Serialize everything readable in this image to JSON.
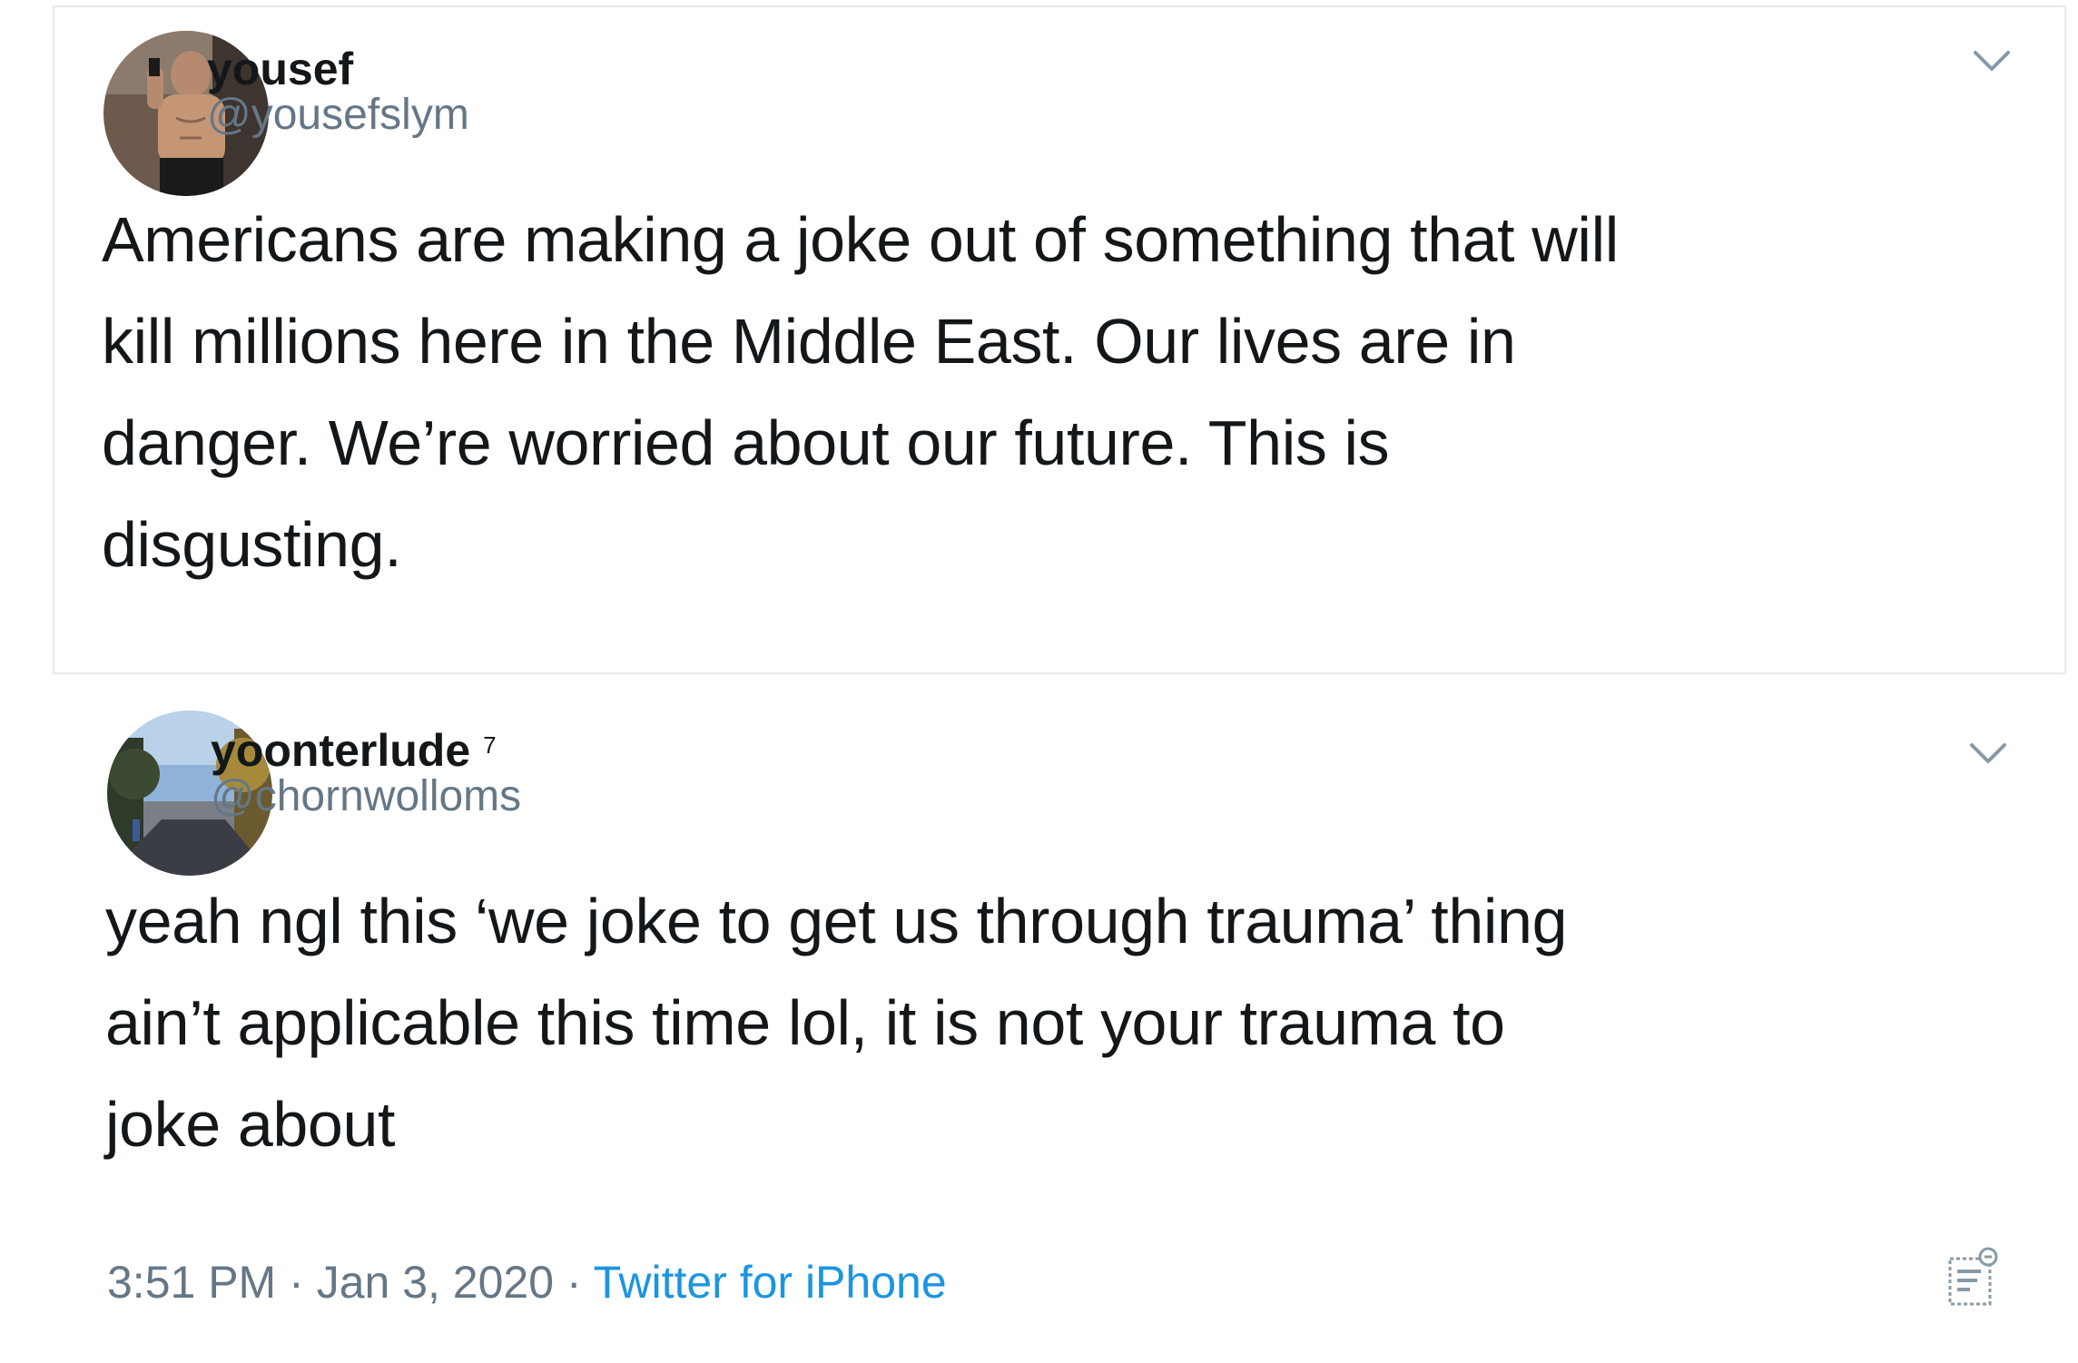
{
  "tweets": [
    {
      "display_name": "yousef",
      "handle": "@yousefslym",
      "text": "Americans are making a joke out of something that will\nkill millions here in the Middle East. Our lives are in\ndanger. We’re worried about our future. This is\ndisgusting.",
      "avatar_icon": "avatar-photo-shirtless-selfie",
      "menu_icon": "chevron-down-icon"
    },
    {
      "display_name": "yoonterlude",
      "name_suffix": "7",
      "handle": "@chornwolloms",
      "text": "yeah ngl this ‘we joke to get us through trauma’ thing\nain’t applicable this time lol, it is not your trauma to\njoke about",
      "avatar_icon": "avatar-photo-street-trees",
      "menu_icon": "chevron-down-icon",
      "time": "3:51 PM",
      "separator": "·",
      "date": "Jan 3, 2020",
      "source": "Twitter for iPhone",
      "analytics_icon": "tweet-analytics-icon"
    }
  ],
  "colors": {
    "text": "#14171a",
    "secondary": "#657786",
    "link": "#1b95e0",
    "border": "#e6ecf0"
  }
}
